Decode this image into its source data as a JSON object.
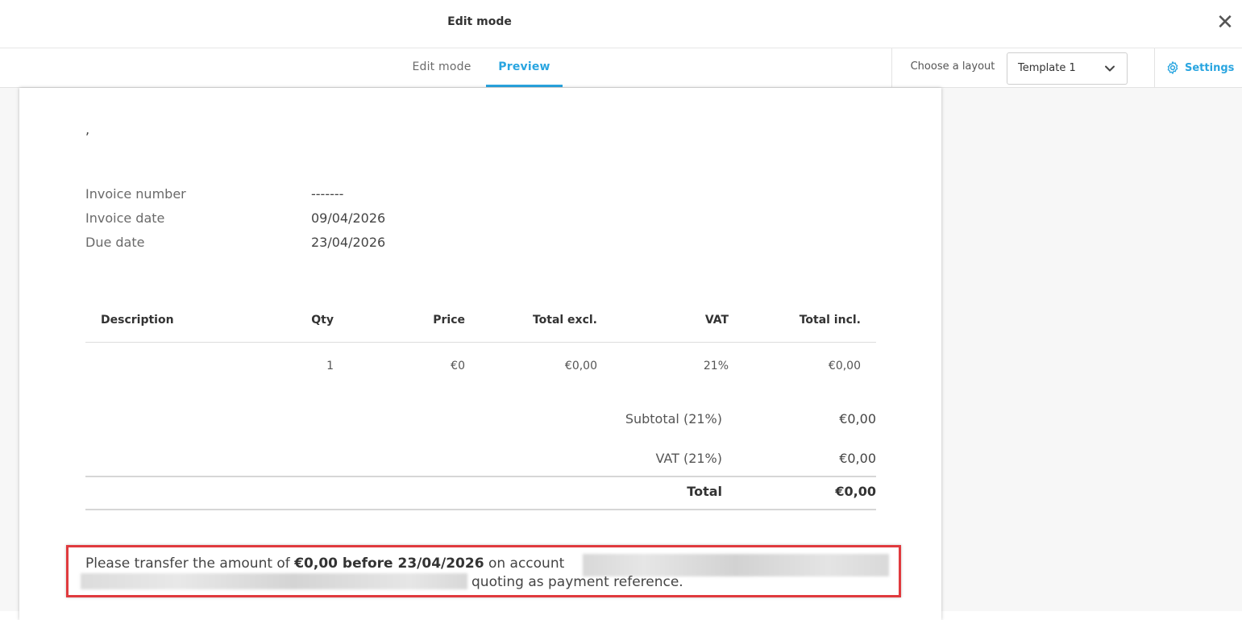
{
  "window": {
    "title": "Edit mode",
    "close_glyph": "✕"
  },
  "tabs": {
    "edit_label": "Edit mode",
    "preview_label": "Preview",
    "active": "Preview"
  },
  "toolbar": {
    "layout_label": "Choose a layout",
    "layout_value": "Template 1",
    "settings_label": "Settings"
  },
  "invoice": {
    "address_fragment": ",",
    "meta": [
      {
        "label": "Invoice number",
        "value": "-------"
      },
      {
        "label": "Invoice date",
        "value": "09/04/2026"
      },
      {
        "label": "Due date",
        "value": "23/04/2026"
      }
    ],
    "table": {
      "headers": [
        "Description",
        "Qty",
        "Price",
        "Total excl.",
        "VAT",
        "Total incl."
      ],
      "rows": [
        {
          "description": "",
          "qty": "1",
          "price": "€0",
          "total_excl": "€0,00",
          "vat": "21%",
          "total_incl": "€0,00"
        }
      ]
    },
    "summary": [
      {
        "label": "Subtotal (21%)",
        "value": "€0,00"
      },
      {
        "label": "VAT (21%)",
        "value": "€0,00"
      },
      {
        "label": "Total",
        "value": "€0,00"
      }
    ],
    "payment_note": {
      "prefix": "Please transfer the amount of ",
      "bold": "€0,00 before 23/04/2026",
      "suffix": " on account",
      "line2": "quoting  as payment reference."
    }
  },
  "colors": {
    "accent": "#29a5e0",
    "highlight_border": "#e03a3e"
  }
}
